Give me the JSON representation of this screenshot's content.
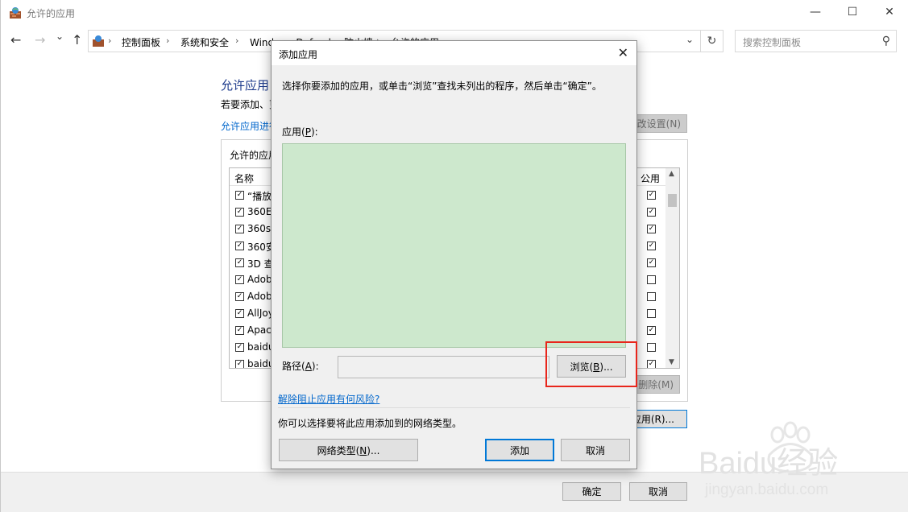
{
  "window": {
    "title": "允许的应用"
  },
  "nav": {
    "back": "←",
    "forward": "→",
    "recent": "⌄",
    "up": "↑",
    "breadcrumbs": [
      "控制面板",
      "系统和安全",
      "Windows Defender 防火墙",
      "允许的应用"
    ],
    "refresh": "↻",
    "search_placeholder": "搜索控制面板"
  },
  "background": {
    "title": "允许应用",
    "desc": "若要添加、更",
    "link": "允许应用进行",
    "change_settings_btn": "改设置(N)",
    "group_label": "允许的应用",
    "columns": {
      "name": "名称",
      "public": "公用"
    },
    "rows": [
      {
        "name": "“播放",
        "checked": true,
        "public": true
      },
      {
        "name": "360Ev",
        "checked": true,
        "public": true
      },
      {
        "name": "360sa",
        "checked": true,
        "public": true
      },
      {
        "name": "360安",
        "checked": true,
        "public": true
      },
      {
        "name": "3D 查",
        "checked": true,
        "public": true
      },
      {
        "name": "Adob",
        "checked": true,
        "public": false
      },
      {
        "name": "Adob",
        "checked": true,
        "public": false
      },
      {
        "name": "AllJoy",
        "checked": true,
        "public": false
      },
      {
        "name": "Apach",
        "checked": true,
        "public": true
      },
      {
        "name": "baidu",
        "checked": true,
        "public": false
      },
      {
        "name": "baidu",
        "checked": true,
        "public": true
      }
    ],
    "remove_btn": "删除(M)",
    "allow_other_btn": "应用(R)...",
    "ok_btn": "确定",
    "cancel_btn": "取消"
  },
  "dialog": {
    "title": "添加应用",
    "instruction": "选择你要添加的应用，或单击“浏览”查找未列出的程序，然后单击“确定”。",
    "apps_label": "应用",
    "apps_key": "P",
    "path_label": "路径",
    "path_key": "A",
    "path_value": "",
    "browse_btn": "浏览",
    "browse_key": "B",
    "risk_link": "解除阻止应用有何风险?",
    "network_text": "你可以选择要将此应用添加到的网络类型。",
    "network_btn": "网络类型",
    "network_key": "N",
    "add_btn": "添加",
    "cancel_btn": "取消"
  },
  "watermark": {
    "brand": "Baidu经验",
    "url": "jingyan.baidu.com"
  },
  "colors": {
    "selection_green": "#cde8cd",
    "link_blue": "#0066cc",
    "highlight_red": "#e8261c",
    "title_blue": "#1e3b8c"
  }
}
